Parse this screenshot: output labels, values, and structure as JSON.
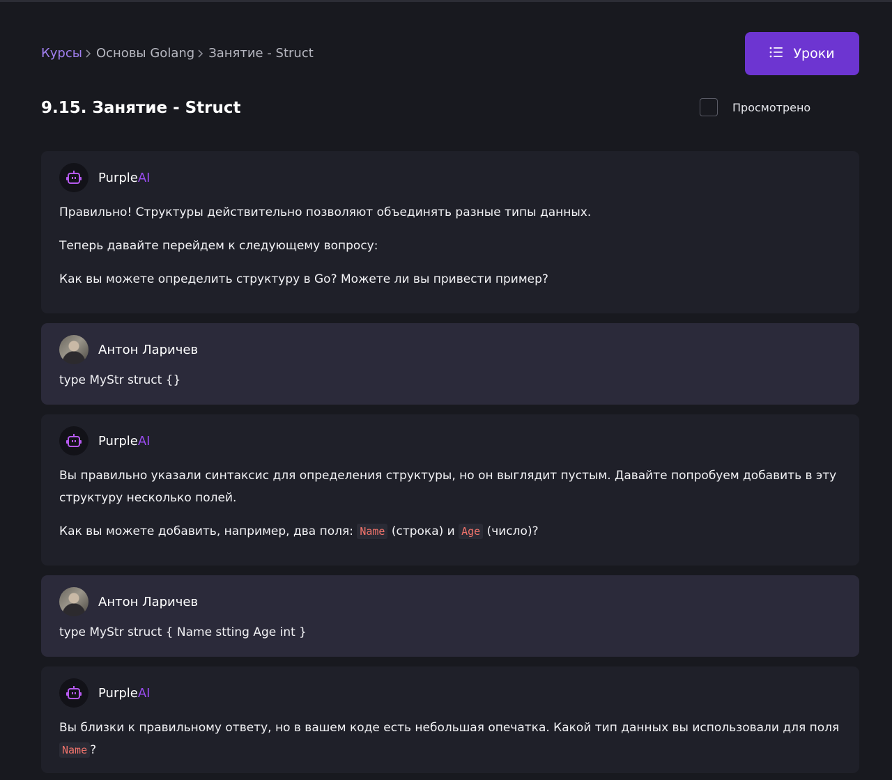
{
  "breadcrumb": {
    "root": "Курсы",
    "course": "Основы Golang",
    "current": "Занятие - Struct"
  },
  "lessons_button": {
    "label": "Уроки"
  },
  "page_title": "9.15. Занятие - Struct",
  "viewed": {
    "label": "Просмотрено",
    "checked": false
  },
  "ai_name": {
    "base": "Purple",
    "accent": "AI"
  },
  "messages": [
    {
      "author": "PurpleAI",
      "paragraphs": [
        "Правильно! Структуры действительно позволяют объединять разные типы данных.",
        "Теперь давайте перейдем к следующему вопросу:",
        "Как вы можете определить структуру в Go? Можете ли вы привести пример?"
      ]
    },
    {
      "author": "Антон Ларичев",
      "text": "type MyStr struct {}"
    },
    {
      "author": "PurpleAI",
      "p1": "Вы правильно указали синтаксис для определения структуры, но он выглядит пустым. Давайте попробуем добавить в эту структуру несколько полей.",
      "p2_a": "Как вы можете добавить, например, два поля: ",
      "code1": "Name",
      "p2_b": " (строка) и ",
      "code2": "Age",
      "p2_c": " (число)?"
    },
    {
      "author": "Антон Ларичев",
      "text": "type MyStr struct { Name stting Age int }"
    },
    {
      "author": "PurpleAI",
      "p1_a": "Вы близки к правильному ответу, но в вашем коде есть небольшая опечатка. Какой тип данных вы использовали для поля ",
      "code1": "Name",
      "p1_b": "?"
    }
  ],
  "colors": {
    "background": "#18191f",
    "accent": "#6d35d1",
    "link": "#a17ff0",
    "ai_accent": "#9a4cf0",
    "code": "#f0736b"
  }
}
